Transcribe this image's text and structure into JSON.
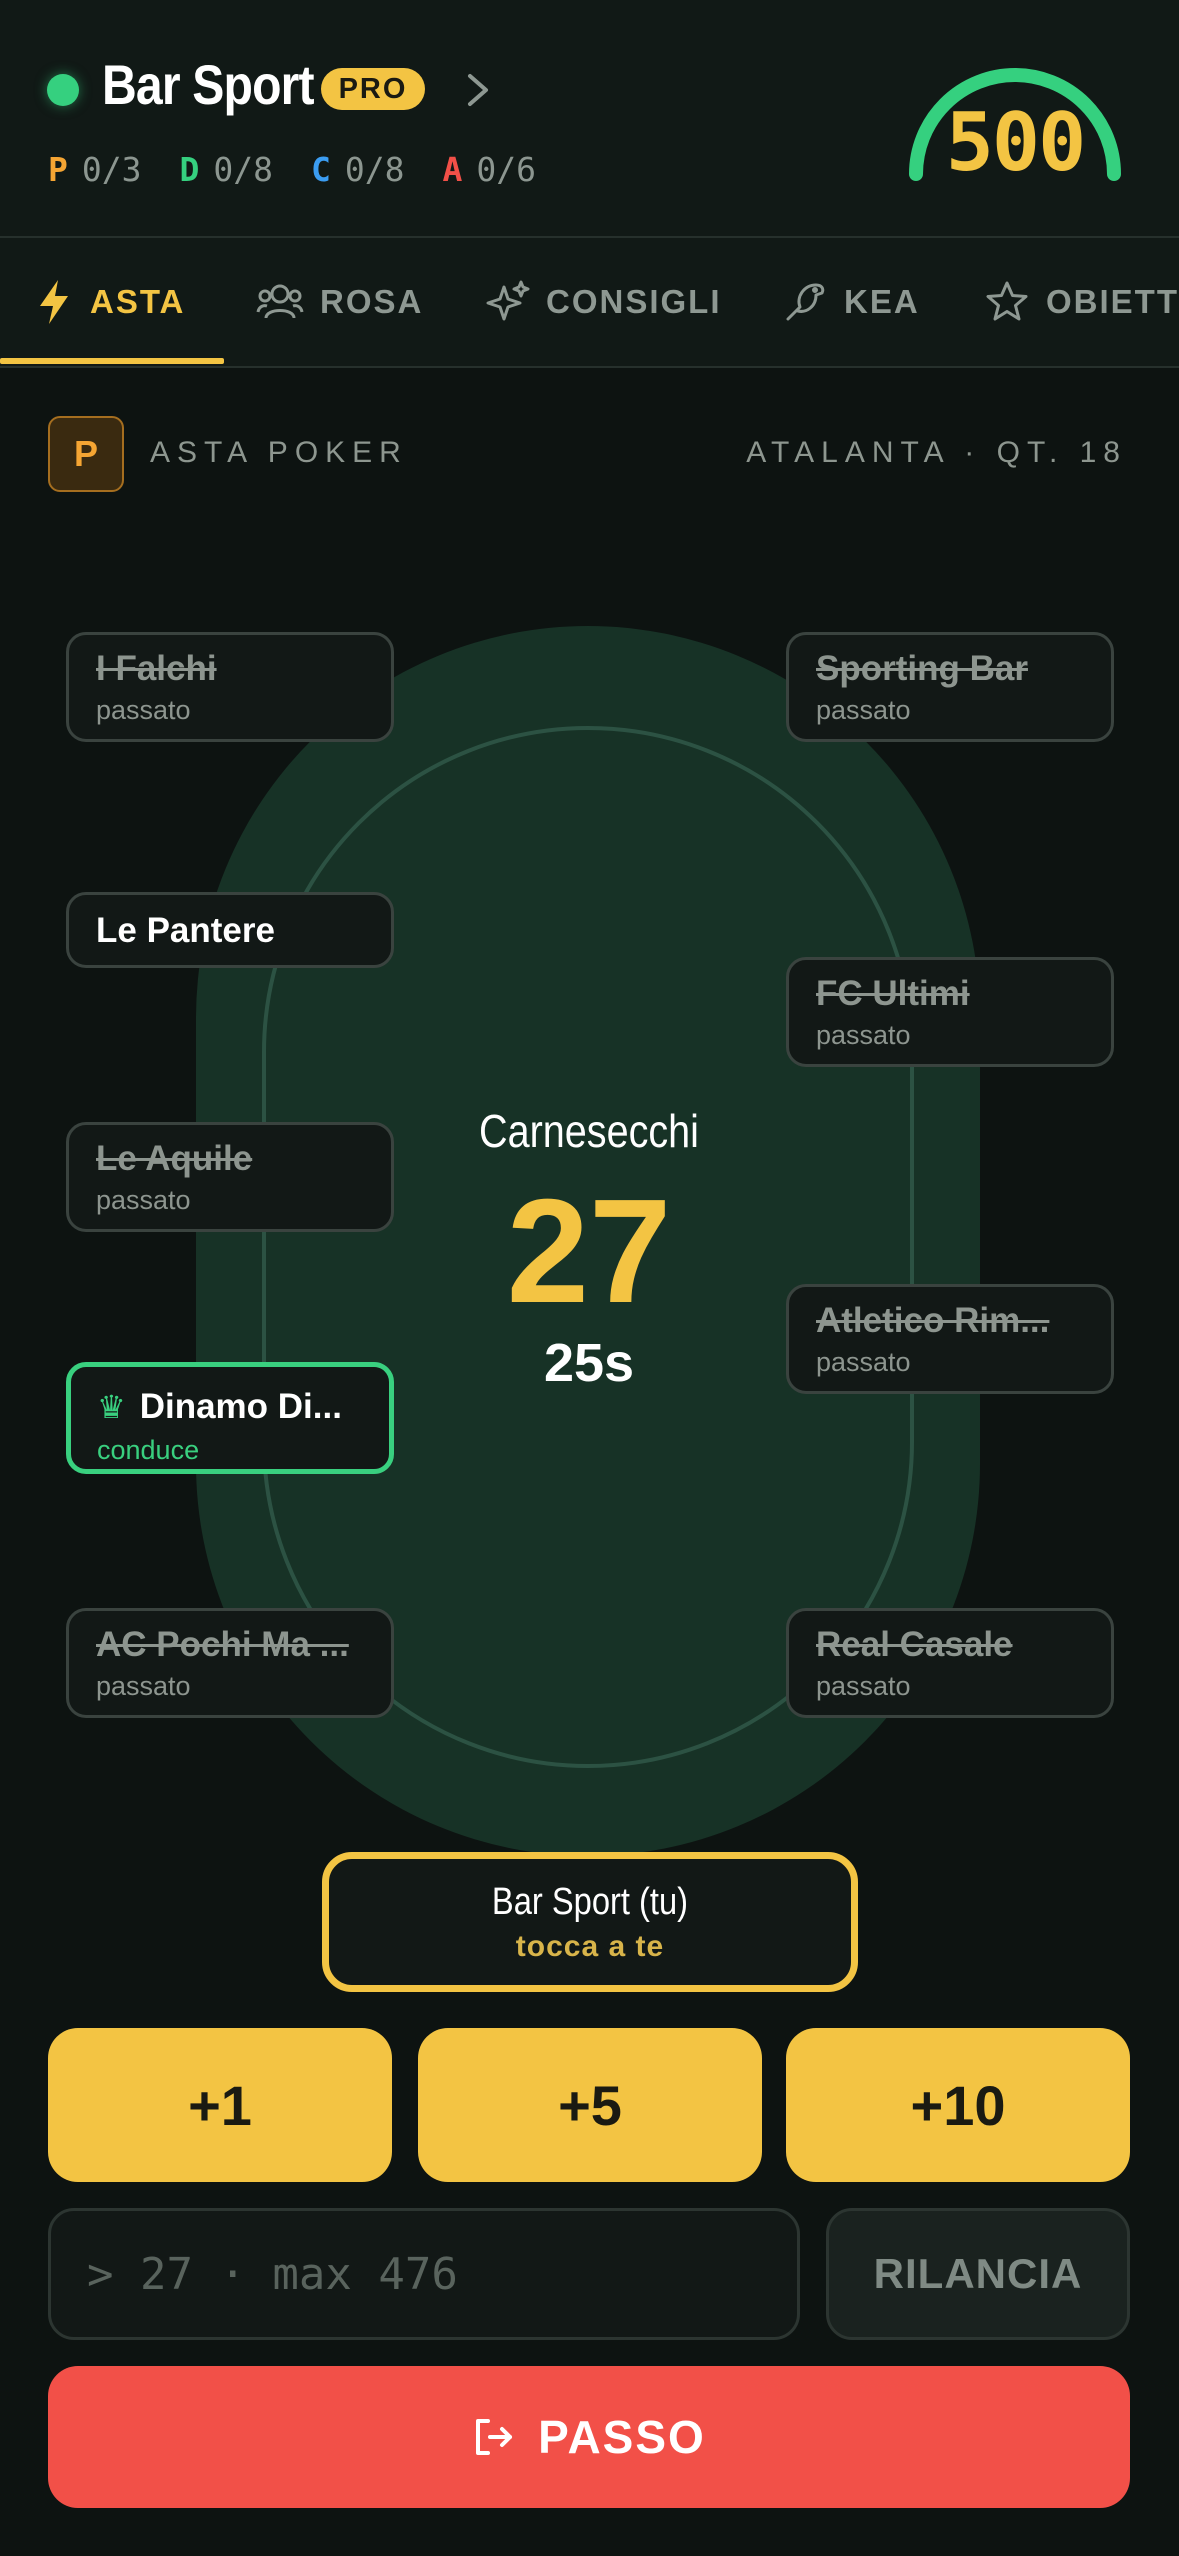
{
  "header": {
    "club_name": "Bar Sport",
    "badge": "PRO",
    "budget": "500",
    "status_color": "#35d07f",
    "roles": [
      {
        "key": "P",
        "value": "0/3",
        "color": "#f5a533"
      },
      {
        "key": "D",
        "value": "0/8",
        "color": "#35d07f"
      },
      {
        "key": "C",
        "value": "0/8",
        "color": "#3b9df2"
      },
      {
        "key": "A",
        "value": "0/6",
        "color": "#f25048"
      }
    ]
  },
  "tabs": [
    {
      "label": "ASTA",
      "icon": "lightning-icon",
      "active": true
    },
    {
      "label": "ROSA",
      "icon": "users-icon",
      "active": false
    },
    {
      "label": "CONSIGLI",
      "icon": "sparkles-icon",
      "active": false
    },
    {
      "label": "KEA",
      "icon": "bird-icon",
      "active": false
    },
    {
      "label": "OBIETT",
      "icon": "star-icon",
      "active": false
    }
  ],
  "auction": {
    "role_badge": "P",
    "type": "ASTA POKER",
    "player_info": "ATALANTA · QT. 18",
    "player_name": "Carnesecchi",
    "current_bid": "27",
    "timer": "25s"
  },
  "seats": {
    "left": [
      {
        "name": "I Falchi",
        "status": "passato",
        "out": true
      },
      {
        "name": "Le Pantere",
        "status": "",
        "out": false
      },
      {
        "name": "Le Aquile",
        "status": "passato",
        "out": true
      },
      {
        "name": "Dinamo Di...",
        "status": "conduce",
        "out": false,
        "leader": true
      },
      {
        "name": "AC Pochi Ma ...",
        "status": "passato",
        "out": true
      }
    ],
    "right": [
      {
        "name": "Sporting Bar",
        "status": "passato",
        "out": true
      },
      {
        "name": "FC Ultimi",
        "status": "passato",
        "out": true
      },
      {
        "name": "Atletico Rim...",
        "status": "passato",
        "out": true
      },
      {
        "name": "Real Casale",
        "status": "passato",
        "out": true
      }
    ]
  },
  "turn": {
    "name": "Bar Sport (tu)",
    "note": "tocca a te"
  },
  "controls": {
    "inc1": "+1",
    "inc5": "+5",
    "inc10": "+10",
    "bid_placeholder": "> 27 · max 476",
    "raise_label": "RILANCIA",
    "pass_label": "PASSO"
  },
  "colors": {
    "accent": "#f3c443",
    "leader": "#39d07f",
    "danger": "#f25048",
    "felt": "#173226"
  }
}
